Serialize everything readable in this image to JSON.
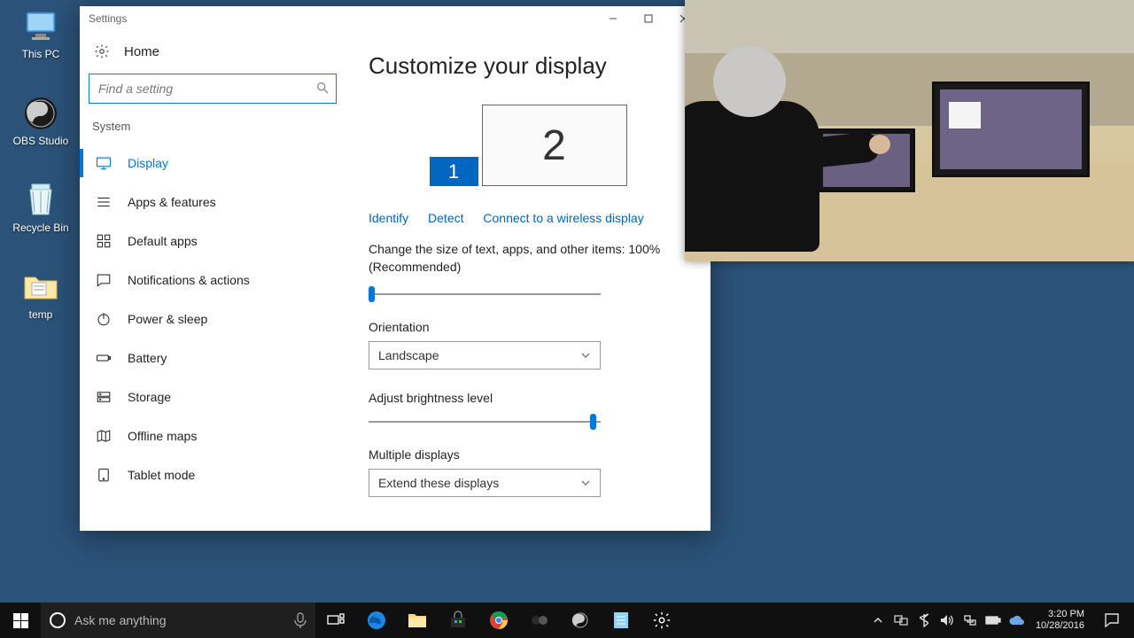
{
  "desktop": {
    "icons": [
      {
        "name": "this-pc",
        "label": "This PC"
      },
      {
        "name": "obs-studio",
        "label": "OBS Studio"
      },
      {
        "name": "recycle-bin",
        "label": "Recycle Bin"
      },
      {
        "name": "temp-folder",
        "label": "temp"
      }
    ]
  },
  "settings": {
    "window_title": "Settings",
    "home_label": "Home",
    "search_placeholder": "Find a setting",
    "section_label": "System",
    "nav": [
      {
        "label": "Display",
        "icon": "display",
        "active": true
      },
      {
        "label": "Apps & features",
        "icon": "apps"
      },
      {
        "label": "Default apps",
        "icon": "defaults"
      },
      {
        "label": "Notifications & actions",
        "icon": "notify"
      },
      {
        "label": "Power & sleep",
        "icon": "power"
      },
      {
        "label": "Battery",
        "icon": "battery"
      },
      {
        "label": "Storage",
        "icon": "storage"
      },
      {
        "label": "Offline maps",
        "icon": "maps"
      },
      {
        "label": "Tablet mode",
        "icon": "tablet"
      }
    ],
    "content": {
      "heading": "Customize your display",
      "monitor1": "1",
      "monitor2": "2",
      "link_identify": "Identify",
      "link_detect": "Detect",
      "link_wireless": "Connect to a wireless display",
      "scale_label": "Change the size of text, apps, and other items: 100% (Recommended)",
      "scale_percent": 0,
      "orientation_label": "Orientation",
      "orientation_value": "Landscape",
      "brightness_label": "Adjust brightness level",
      "brightness_percent": 98,
      "multiple_label": "Multiple displays",
      "multiple_value": "Extend these displays"
    }
  },
  "taskbar": {
    "cortana_placeholder": "Ask me anything",
    "time": "3:20 PM",
    "date": "10/28/2016"
  }
}
